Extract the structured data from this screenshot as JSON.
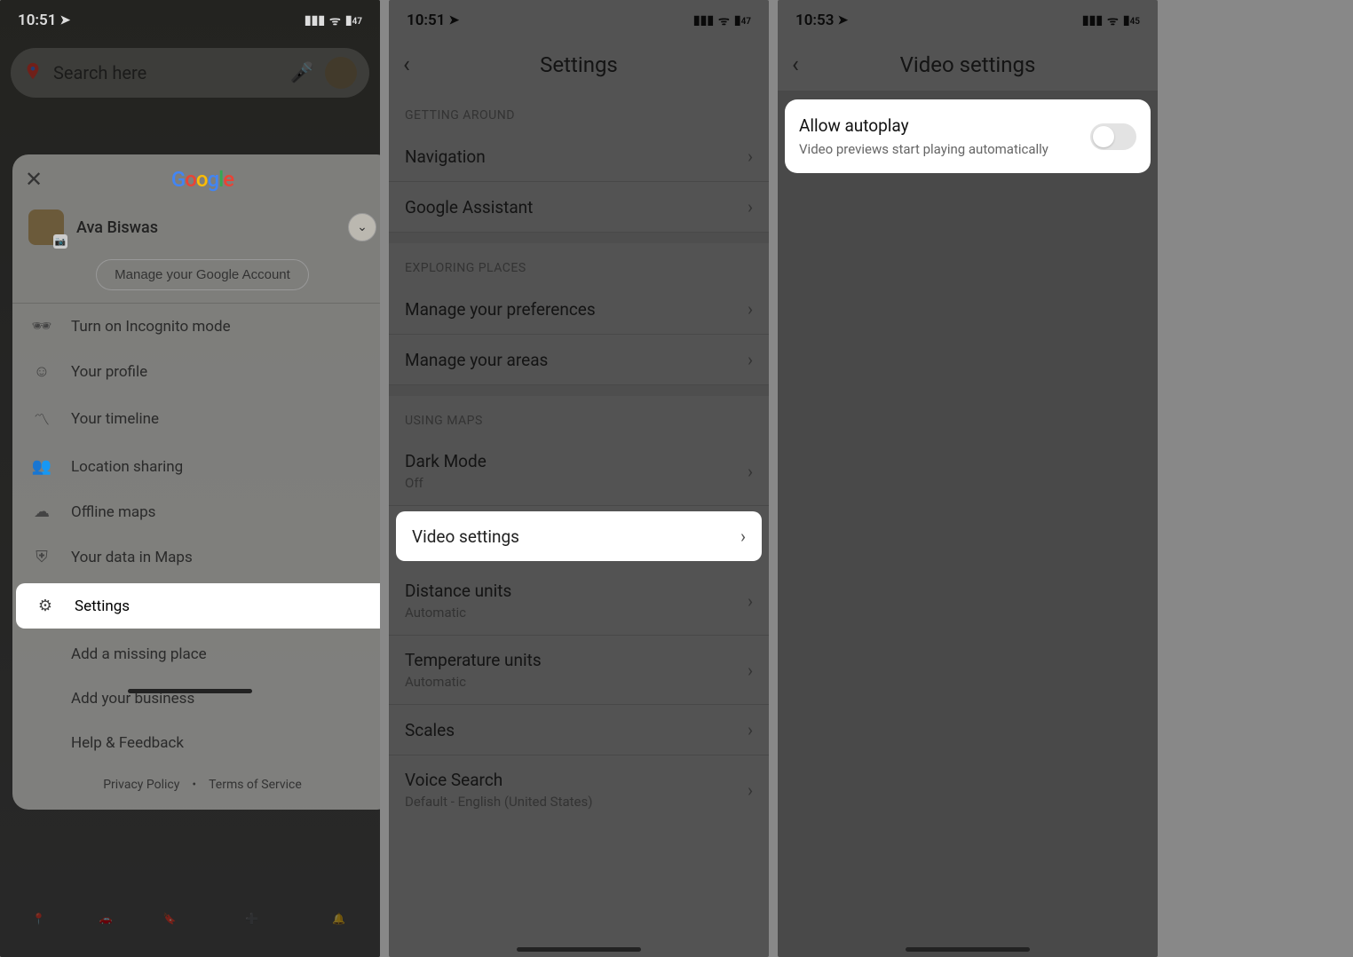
{
  "screen1": {
    "status": {
      "time": "10:51",
      "battery": "47"
    },
    "search_placeholder": "Search here",
    "account": {
      "name": "Ava Biswas",
      "manage": "Manage your Google Account"
    },
    "menu": {
      "incognito": "Turn on Incognito mode",
      "profile": "Your profile",
      "timeline": "Your timeline",
      "location": "Location sharing",
      "offline": "Offline maps",
      "data": "Your data in Maps",
      "settings": "Settings",
      "missing": "Add a missing place",
      "business": "Add your business",
      "help": "Help & Feedback"
    },
    "footer": {
      "privacy": "Privacy Policy",
      "terms": "Terms of Service"
    },
    "tabs": {
      "explore": "Explore",
      "go": "Go",
      "saved": "Saved",
      "contribute": "Contribute",
      "updates": "Updates"
    }
  },
  "screen2": {
    "status": {
      "time": "10:51",
      "battery": "47"
    },
    "title": "Settings",
    "sections": {
      "getting_around": "GETTING AROUND",
      "exploring": "EXPLORING PLACES",
      "using": "USING MAPS"
    },
    "rows": {
      "navigation": "Navigation",
      "assistant": "Google Assistant",
      "prefs": "Manage your preferences",
      "areas": "Manage your areas",
      "dark": "Dark Mode",
      "dark_sub": "Off",
      "video": "Video settings",
      "distance": "Distance units",
      "distance_sub": "Automatic",
      "temp": "Temperature units",
      "temp_sub": "Automatic",
      "scales": "Scales",
      "voice": "Voice Search",
      "voice_sub": "Default - English (United States)"
    }
  },
  "screen3": {
    "status": {
      "time": "10:53",
      "battery": "45"
    },
    "title": "Video settings",
    "toggle": {
      "title": "Allow autoplay",
      "sub": "Video previews start playing automatically"
    }
  }
}
